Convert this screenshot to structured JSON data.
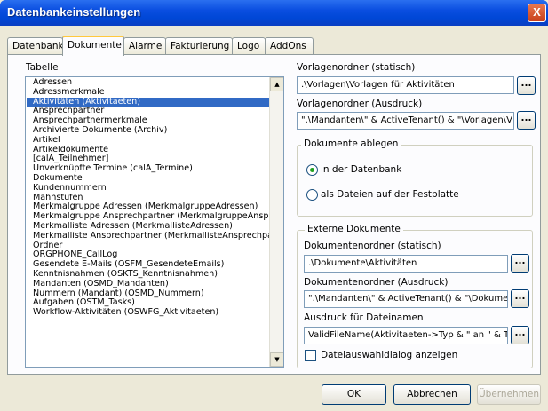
{
  "window": {
    "title": "Datenbankeinstellungen",
    "close_glyph": "X"
  },
  "tabs": [
    {
      "label": "Datenbank",
      "active": false
    },
    {
      "label": "Dokumente",
      "active": true
    },
    {
      "label": "Alarme",
      "active": false
    },
    {
      "label": "Fakturierung",
      "active": false
    },
    {
      "label": "Logo",
      "active": false
    },
    {
      "label": "AddOns",
      "active": false
    }
  ],
  "table_section": {
    "label": "Tabelle",
    "items": [
      "Adressen",
      "Adressmerkmale",
      "Aktivitäten (Aktivitaeten)",
      "Ansprechpartner",
      "Ansprechpartnermerkmale",
      "Archivierte Dokumente (Archiv)",
      "Artikel",
      "Artikeldokumente",
      "[calA_Teilnehmer]",
      "Unverknüpfte Termine (calA_Termine)",
      "Dokumente",
      "Kundennummern",
      "Mahnstufen",
      "Merkmalgruppe Adressen (MerkmalgruppeAdressen)",
      "Merkmalgruppe Ansprechpartner (MerkmalgruppeAnspr",
      "Merkmalliste Adressen (MerkmallisteAdressen)",
      "Merkmalliste Ansprechpartner (MerkmallisteAnsprechpa",
      "Ordner",
      "ORGPHONE_CallLog",
      "Gesendete E-Mails (OSFM_GesendeteEmails)",
      "Kenntnisnahmen (OSKTS_Kenntnisnahmen)",
      "Mandanten (OSMD_Mandanten)",
      "Nummern (Mandant) (OSMD_Nummern)",
      "Aufgaben (OSTM_Tasks)",
      "Workflow-Aktivitäten (OSWFG_Aktivitaeten)"
    ],
    "selected_index": 2,
    "scroll_up": "▲",
    "scroll_down": "▼"
  },
  "templates": {
    "static_label": "Vorlagenordner (statisch)",
    "static_value": ".\\Vorlagen\\Vorlagen für Aktivitäten",
    "print_label": "Vorlagenordner (Ausdruck)",
    "print_value": "\".\\Mandanten\\\" & ActiveTenant() & \"\\Vorlagen\\V",
    "browse": "..."
  },
  "storage": {
    "title": "Dokumente ablegen",
    "option_db": "in der Datenbank",
    "option_files": "als Dateien auf der Festplatte",
    "selected": "db"
  },
  "external": {
    "title": "Externe Dokumente",
    "static_label": "Dokumentenordner (statisch)",
    "static_value": ".\\Dokumente\\Aktivitäten",
    "print_label": "Dokumentenordner (Ausdruck)",
    "print_value": "\".\\Mandanten\\\" & ActiveTenant() & \"\\Dokume",
    "filename_label": "Ausdruck für Dateinamen",
    "filename_value": "ValidFileName(Aktivitaeten->Typ & \" an \" & Til",
    "dialog_label": "Dateiauswahldialog anzeigen",
    "dialog_checked": false,
    "browse": "..."
  },
  "footer": {
    "ok": "OK",
    "cancel": "Abbrechen",
    "apply": "Übernehmen"
  },
  "colors": {
    "title_bar": "#0a4ee0",
    "selection": "#316ac5",
    "tab_highlight": "#ffc83c"
  }
}
